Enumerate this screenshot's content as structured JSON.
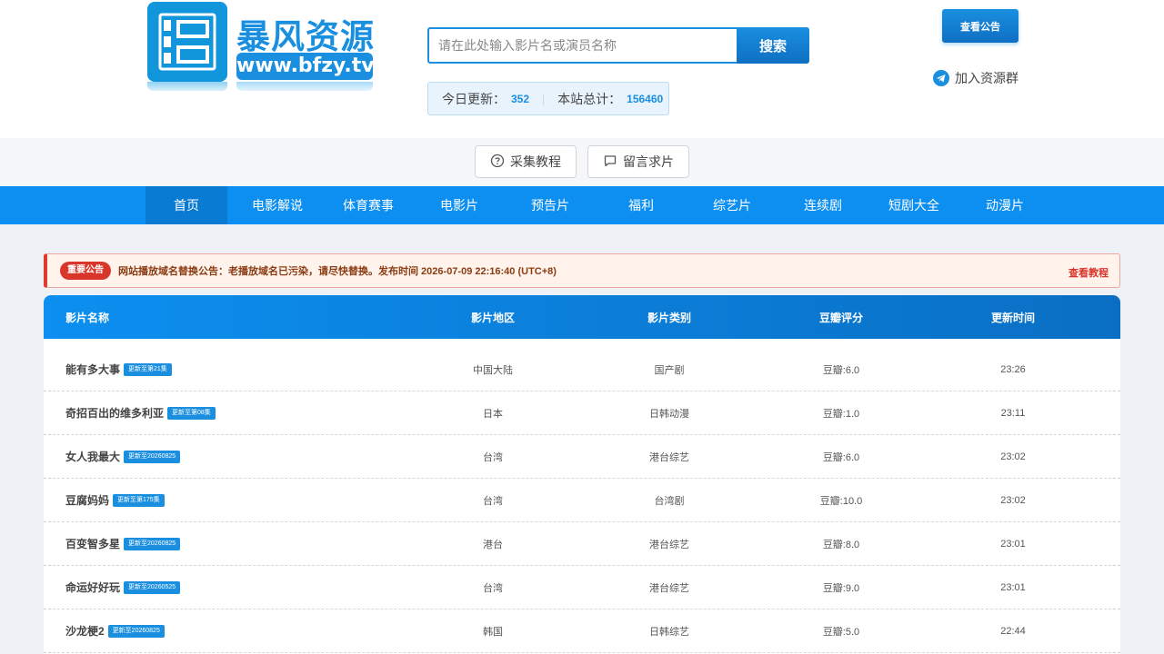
{
  "logo": {
    "title": "暴风资源",
    "url": "www.bfzy.tv",
    "brand_color": "#1a8fe0"
  },
  "search": {
    "placeholder": "请在此处输入影片名或演员名称",
    "button_label": "搜索"
  },
  "stats": {
    "today_label": "今日更新：",
    "today_value": "352",
    "total_label": "本站总计：",
    "total_value": "156460"
  },
  "header_actions": {
    "notice_button": "查看公告",
    "join_group": "加入资源群",
    "join_icon": "telegram-icon"
  },
  "subbar": {
    "tutorial_label": "采集教程",
    "tutorial_icon": "question-circle-icon",
    "request_label": "留言求片",
    "request_icon": "message-icon"
  },
  "nav": {
    "items": [
      "首页",
      "电影解说",
      "体育赛事",
      "电影片",
      "预告片",
      "福利",
      "综艺片",
      "连续剧",
      "短剧大全",
      "动漫片"
    ],
    "active": "首页"
  },
  "announcement": {
    "badge": "重要公告",
    "text": "网站播放域名替换公告：老播放域名已污染，请尽快替换。发布时间 2026-07-09 22:16:40 (UTC+8)",
    "link": "查看教程"
  },
  "table": {
    "headers": [
      "影片名称",
      "影片地区",
      "影片类别",
      "豆瓣评分",
      "更新时间"
    ],
    "rows": [
      {
        "title": "能有多大事",
        "tag": "更新至第21集",
        "region": "中国大陆",
        "category": "国产剧",
        "score": "豆瓣:6.0",
        "time": "23:26"
      },
      {
        "title": "奇招百出的维多利亚",
        "tag": "更新至第08集",
        "region": "日本",
        "category": "日韩动漫",
        "score": "豆瓣:1.0",
        "time": "23:11"
      },
      {
        "title": "女人我最大",
        "tag": "更新至20260825",
        "region": "台湾",
        "category": "港台综艺",
        "score": "豆瓣:6.0",
        "time": "23:02"
      },
      {
        "title": "豆腐妈妈",
        "tag": "更新至第175集",
        "region": "台湾",
        "category": "台湾剧",
        "score": "豆瓣:10.0",
        "time": "23:02"
      },
      {
        "title": "百变智多星",
        "tag": "更新至20260825",
        "region": "港台",
        "category": "港台综艺",
        "score": "豆瓣:8.0",
        "time": "23:01"
      },
      {
        "title": "命运好好玩",
        "tag": "更新至20260525",
        "region": "台湾",
        "category": "港台综艺",
        "score": "豆瓣:9.0",
        "time": "23:01"
      },
      {
        "title": "沙龙梗2",
        "tag": "更新至20260825",
        "region": "韩国",
        "category": "日韩综艺",
        "score": "豆瓣:5.0",
        "time": "22:44"
      }
    ]
  }
}
